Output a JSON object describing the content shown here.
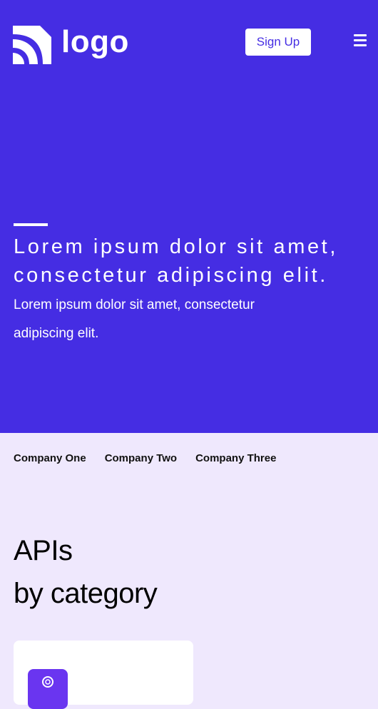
{
  "header": {
    "logo_text": "logo",
    "logo_icon": "wifi-arcs-icon",
    "signup_label": "Sign Up",
    "menu_icon": "hamburger-menu-icon"
  },
  "hero": {
    "headline": "Lorem ipsum dolor sit amet, consectetur adipiscing elit.",
    "subtext": "Lorem ipsum dolor sit amet, consectetur adipiscing elit.",
    "background_color": "#452de3"
  },
  "companies": [
    "Company One",
    "Company Two",
    "Company Three"
  ],
  "apis_section": {
    "title_line1": "APIs",
    "title_line2": "by category",
    "card_icon": "location-pin-icon",
    "card_icon_color": "#6a35f0"
  }
}
